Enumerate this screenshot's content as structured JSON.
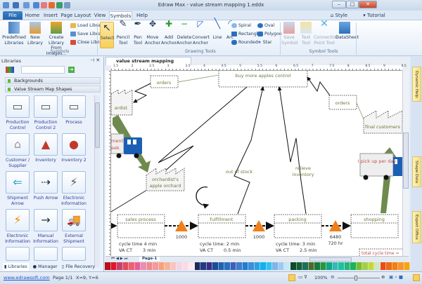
{
  "app": {
    "title": "Edraw Max - value stream mapping 1.eddx"
  },
  "menu_tabs": [
    "File",
    "Home",
    "Insert",
    "Page Layout",
    "View",
    "Symbols",
    "Help"
  ],
  "active_tab": "Symbols",
  "top_right": {
    "style": "Style",
    "tutorial": "Tutorial"
  },
  "ribbon": {
    "symbols_group": {
      "label": "Symbols",
      "predefined": "Predefined Libraries",
      "new_library": "New Library",
      "create_library": "Create Library From Images...",
      "load": "Load Library",
      "save": "Save Library",
      "close": "Close Library"
    },
    "drawing_group": {
      "label": "Drawing Tools",
      "select": "Select",
      "pencil": "Pencil Tool",
      "pen": "Pen Tool",
      "move_anchor": "Move Anchor",
      "add_anchor": "Add Anchor",
      "delete_anchor": "Delete Anchor",
      "convert_anchor": "Convert Anchor",
      "line": "Line",
      "arc": "Arc",
      "spiral": "Spiral",
      "rectangle": "Rectangle",
      "rounded": "Rounded",
      "oval": "Oval",
      "polygon": "Polygon",
      "star": "Star"
    },
    "symbol_tools_group": {
      "label": "Symbol Tools",
      "save_symbol": "Save Symbol",
      "text_tool": "Text Tool",
      "connection_point": "Connection Point Tool",
      "datasheet": "DataSheet"
    }
  },
  "libraries": {
    "title": "Libraries",
    "search_value": "",
    "categories": [
      "Backgrounds",
      "Value Stream Map Shapes"
    ],
    "shapes": [
      "Production Control",
      "Production Control 2",
      "Process",
      "Customer / Supplier",
      "Inventory",
      "Inventory 2",
      "Shipment Arrow",
      "Push Arrow",
      "Electronic Information",
      "Electronic Information",
      "Manual Information",
      "External Shipment"
    ],
    "bottom_tabs": [
      "Libraries",
      "Manager",
      "File Recovery"
    ]
  },
  "document": {
    "tab": "value stream mapping 1.eddx",
    "page_tab": "Page-1",
    "ruler_ticks": [
      "1.5",
      "2",
      "2.5",
      "3",
      "3.5",
      "4",
      "4.5",
      "5",
      "5.5",
      "6",
      "6.5",
      "7",
      "7.5",
      "8",
      "8.5",
      "9",
      "9.5"
    ]
  },
  "diagram": {
    "control": "buy more apples control",
    "orders1": "orders",
    "orders2": "orders",
    "orchardist_partial": "ardist",
    "truck_left_text": [
      "ment",
      "eek"
    ],
    "orchard": [
      "orchardist's",
      "apple orchard"
    ],
    "final_customers": "final customers",
    "truck_right_text": "I pick up per day",
    "out_of_stock": "out of stock",
    "relieve": [
      "relieve",
      "inventory"
    ],
    "processes": [
      {
        "name": "sales process",
        "ct": "cycle time 4 min",
        "va_label": "VA CT",
        "va": "3 min"
      },
      {
        "name": "fulfillment",
        "ct": "cycle time: 2 min",
        "va_label": "VA CT",
        "va": "0.5 min"
      },
      {
        "name": "packing",
        "ct": "cycle time: 3 min",
        "va_label": "VA CT",
        "va": "2.5 min"
      },
      {
        "name": "shopping"
      }
    ],
    "inventories": [
      {
        "qty": "1000"
      },
      {
        "qty": "1000"
      },
      {
        "qty": "6480",
        "time": "720 hr"
      }
    ],
    "total_cycle": "total cycle time ="
  },
  "right_panel": [
    "Dynamic Help",
    "Shape Data",
    "Export Office"
  ],
  "status": {
    "link": "www.edrawsoft.com",
    "page": "Page 1/1",
    "coords": "X=9, Y=6",
    "zoom": "100%"
  },
  "colors": {
    "accent": "#1f5fa8",
    "inventory": "#f07f1a",
    "arrow_green": "#6f8a4e",
    "truck_blue": "#1a5fb4"
  },
  "palette": [
    "#b5121b",
    "#e0162b",
    "#c7426b",
    "#e14b5a",
    "#ee6170",
    "#e85c9a",
    "#e88fb0",
    "#f08a8a",
    "#f29aa0",
    "#f7a07a",
    "#f5b49a",
    "#f9c4c0",
    "#f0d6e6",
    "#fbd9e5",
    "#fde8ef",
    "#1b2a5e",
    "#233a80",
    "#3a2d86",
    "#1d4b96",
    "#1f62b0",
    "#2a6fbf",
    "#3f5fb5",
    "#3f7cc9",
    "#1e7ed0",
    "#3a8fd8",
    "#2aa0e0",
    "#11b0ef",
    "#38c0f0",
    "#7fb5e5",
    "#9ccbf0",
    "#c8e4f5",
    "#0f4a2a",
    "#126036",
    "#1f6f5a",
    "#4d6b27",
    "#157a3a",
    "#27963f",
    "#11a58a",
    "#3ab7b0",
    "#1ec1a0",
    "#2ab37a",
    "#19b45a",
    "#7dbb2a",
    "#a4cf4c",
    "#c1d93b",
    "#cde5c0",
    "#e84c1e",
    "#ec6a14",
    "#f08010",
    "#f5962a",
    "#f6a510"
  ]
}
